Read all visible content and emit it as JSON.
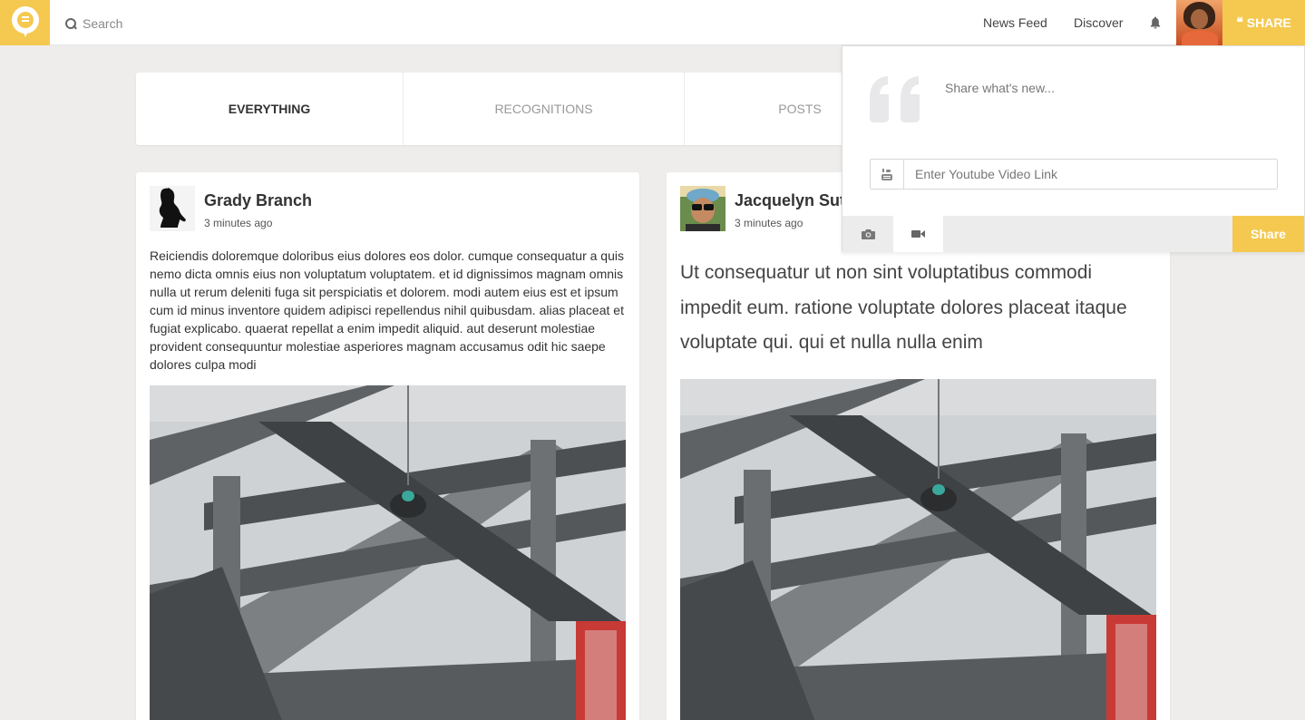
{
  "header": {
    "logo_icon": "chat-bubble-logo-icon",
    "search_placeholder": "Search",
    "nav": [
      {
        "label": "News Feed"
      },
      {
        "label": "Discover"
      }
    ],
    "notification_icon": "bell-icon",
    "share_label": "SHARE",
    "accent": "#f5c950"
  },
  "tabs": [
    {
      "label": "EVERYTHING",
      "active": true
    },
    {
      "label": "RECOGNITIONS",
      "active": false
    },
    {
      "label": "POSTS",
      "active": false
    }
  ],
  "posts": [
    {
      "author": "Grady Branch",
      "time": "3 minutes ago",
      "text": "Reiciendis doloremque doloribus eius dolores eos dolor. cumque consequatur a quis nemo dicta omnis eius non voluptatum voluptatem. et id dignissimos magnam omnis nulla ut rerum deleniti fuga sit perspiciatis et dolorem. modi autem eius est et ipsum cum id minus inventore quidem adipisci repellendus nihil quibusdam. alias placeat et fugiat explicabo. quaerat repellat a enim impedit aliquid. aut deserunt molestiae provident consequuntur molestiae asperiores magnam accusamus odit hic saepe dolores culpa modi"
    },
    {
      "author": "Jacquelyn Sutt",
      "time": "3 minutes ago",
      "text": "Ut consequatur ut non sint voluptatibus commodi impedit eum. ratione voluptate dolores placeat itaque voluptate qui. qui et nulla nulla enim"
    }
  ],
  "share_panel": {
    "placeholder": "Share what's new...",
    "youtube_placeholder": "Enter Youtube Video Link",
    "share_button": "Share",
    "icons": [
      "quote-icon",
      "youtube-icon",
      "camera-icon",
      "video-camera-icon"
    ]
  }
}
